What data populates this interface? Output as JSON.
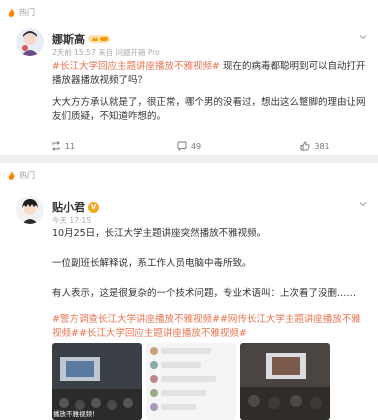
{
  "post1": {
    "hot_label": "热门",
    "author": "娜斯高",
    "meta": "2天前 15:57 来自 问题开箱 Pro",
    "tag": "#长江大学回应主题讲座播放不雅视频#",
    "text_after_tag": " 现在的病毒都聪明到可以自动打开播放器播放视频了吗？",
    "para2": "大大方方承认就是了，很正常，哪个男的没看过，想出这么蹩脚的理由让网友们质疑，不知道咋想的。",
    "reposts": "11",
    "comments": "49",
    "likes": "381"
  },
  "post2": {
    "hot_label": "热门",
    "author": "贴小君",
    "meta": "今天 17:15",
    "para1": "10月25日，长江大学主题讲座突然播放不雅视频。",
    "para2": "一位副班长解释说，系工作人员电脑中毒所致。",
    "para3": "有人表示，这是很复杂的一个技术问题，专业术语叫：上次看了没删……",
    "tag_line": "#警方调查长江大学讲座播放不雅视频##网传长江大学主题讲座播放不雅视频##长江大学回应主题讲座播放不雅视频#",
    "thumb_caption": "播放不雅视频！"
  },
  "colors": {
    "accent": "#eb7350",
    "muted": "#999999",
    "bg": "#f0f0f0"
  }
}
